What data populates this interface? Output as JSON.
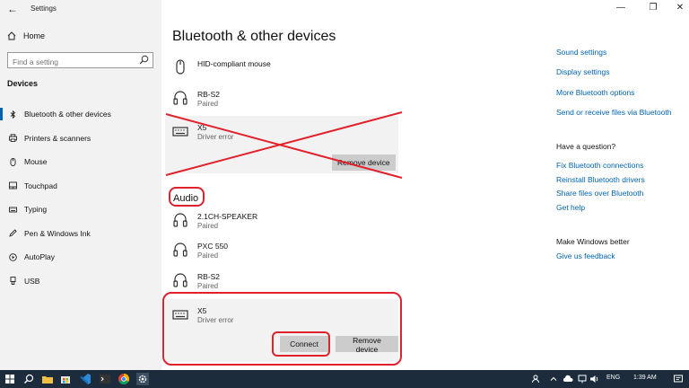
{
  "window": {
    "app_title": "Settings",
    "controls": {
      "minimize": "—",
      "maximize": "❐",
      "close": "✕"
    }
  },
  "sidebar": {
    "home_label": "Home",
    "search": {
      "placeholder": "Find a setting",
      "value": ""
    },
    "section_label": "Devices",
    "items": [
      {
        "label": "Bluetooth & other devices",
        "icon": "bluetooth-icon",
        "active": true
      },
      {
        "label": "Printers & scanners",
        "icon": "printer-icon",
        "active": false
      },
      {
        "label": "Mouse",
        "icon": "mouse-icon",
        "active": false
      },
      {
        "label": "Touchpad",
        "icon": "touchpad-icon",
        "active": false
      },
      {
        "label": "Typing",
        "icon": "keyboard-icon",
        "active": false
      },
      {
        "label": "Pen & Windows Ink",
        "icon": "pen-icon",
        "active": false
      },
      {
        "label": "AutoPlay",
        "icon": "autoplay-icon",
        "active": false
      },
      {
        "label": "USB",
        "icon": "usb-icon",
        "active": false
      }
    ]
  },
  "main": {
    "title": "Bluetooth & other devices",
    "other_devices": [
      {
        "name": "HID-compliant mouse",
        "status": "",
        "icon": "mouse-icon"
      },
      {
        "name": "RB-S2",
        "status": "Paired",
        "icon": "headset-icon"
      },
      {
        "name": "X5",
        "status": "Driver error",
        "icon": "keyboard-icon",
        "remove_label": "Remove device"
      }
    ],
    "audio_label": "Audio",
    "audio_devices": [
      {
        "name": "2.1CH-SPEAKER",
        "status": "Paired",
        "icon": "headset-icon"
      },
      {
        "name": "PXC 550",
        "status": "Paired",
        "icon": "headset-icon"
      },
      {
        "name": "RB-S2",
        "status": "Paired",
        "icon": "headset-icon"
      },
      {
        "name": "X5",
        "status": "Driver error",
        "icon": "keyboard-icon",
        "connect_label": "Connect",
        "remove_label": "Remove device"
      }
    ]
  },
  "right_panel": {
    "related_links": [
      "Sound settings",
      "Display settings",
      "More Bluetooth options",
      "Send or receive files via Bluetooth"
    ],
    "question_heading": "Have a question?",
    "question_links": [
      "Fix Bluetooth connections",
      "Reinstall Bluetooth drivers",
      "Share files over Bluetooth",
      "Get help"
    ],
    "feedback_heading": "Make Windows better",
    "feedback_link": "Give us feedback"
  },
  "taskbar": {
    "language": "ENG",
    "time": "1:39 AM"
  },
  "colors": {
    "accent": "#0063b1",
    "annotation": "#e0222c",
    "sidebar_bg": "#f2f2f2",
    "taskbar_bg": "#1c2c3c"
  }
}
